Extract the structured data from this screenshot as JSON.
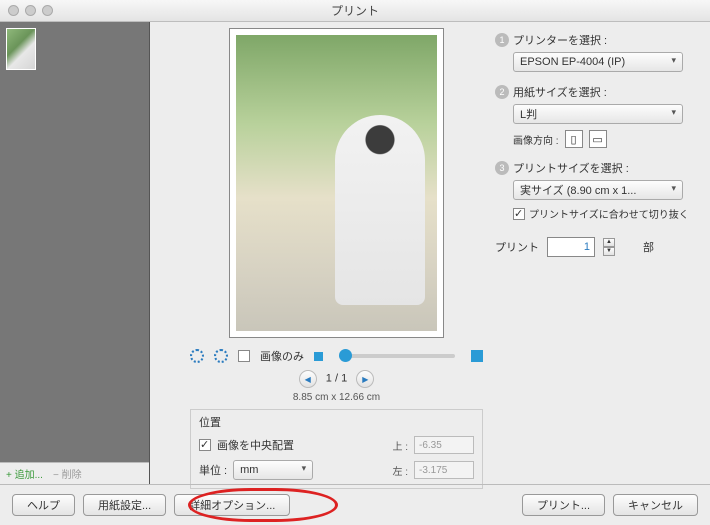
{
  "title": "プリント",
  "sidebar": {
    "add": "追加...",
    "remove": "削除"
  },
  "preview": {
    "image_only": "画像のみ",
    "page_current": 1,
    "page_total": 1,
    "dimensions": "8.85 cm x 12.66 cm"
  },
  "position": {
    "legend": "位置",
    "center_label": "画像を中央配置",
    "unit_label": "単位 :",
    "unit_value": "mm",
    "top_label": "上 :",
    "top_value": "-6.35",
    "left_label": "左 :",
    "left_value": "-3.175"
  },
  "settings": {
    "step1": {
      "label": "プリンターを選択 :",
      "value": "EPSON EP-4004 (IP)"
    },
    "step2": {
      "label": "用紙サイズを選択 :",
      "value": "L判",
      "orient_label": "画像方向 :"
    },
    "step3": {
      "label": "プリントサイズを選択 :",
      "value": "実サイズ (8.90 cm x 1...",
      "crop_label": "プリントサイズに合わせて切り抜く"
    },
    "copies": {
      "label": "プリント",
      "value": "1",
      "unit": "部"
    }
  },
  "buttons": {
    "help": "ヘルプ",
    "page_setup": "用紙設定...",
    "advanced": "詳細オプション...",
    "print": "プリント...",
    "cancel": "キャンセル"
  }
}
